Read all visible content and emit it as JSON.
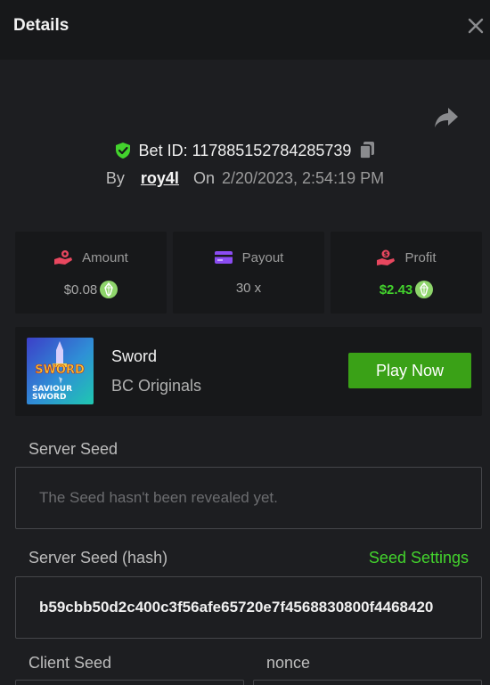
{
  "header": {
    "title": "Details"
  },
  "bet": {
    "id_text": "Bet ID: 117885152784285739",
    "by_label": "By",
    "username": "roy4l",
    "on_label": "On",
    "date": "2/20/2023, 2:54:19 PM"
  },
  "stats": {
    "amount": {
      "label": "Amount",
      "value": "$0.08"
    },
    "payout": {
      "label": "Payout",
      "value": "30 x"
    },
    "profit": {
      "label": "Profit",
      "value": "$2.43"
    }
  },
  "game": {
    "name": "Sword",
    "provider": "BC Originals",
    "play_label": "Play Now",
    "thumb_text_1": "SWORD",
    "thumb_text_2": "SAVIOUR",
    "thumb_text_3": "SWORD"
  },
  "seeds": {
    "server_seed_label": "Server Seed",
    "server_seed_placeholder": "The Seed hasn't been revealed yet.",
    "server_seed_hash_label": "Server Seed (hash)",
    "seed_settings_label": "Seed Settings",
    "server_seed_hash_value": "b59cbb50d2c400c3f56afe65720e7f4568830800f4468420",
    "client_seed_label": "Client Seed",
    "nonce_label": "nonce"
  },
  "colors": {
    "accent_green": "#43d32d",
    "play_button": "#3aa117",
    "background": "#1d1e21",
    "panel": "#17181a"
  },
  "icons": {
    "close": "close-icon",
    "share": "share-icon",
    "verified": "verified-shield-icon",
    "copy": "copy-icon",
    "amount": "bet-hand-icon",
    "payout": "card-icon",
    "profit": "profit-hand-icon",
    "currency": "eos-coin-icon"
  }
}
